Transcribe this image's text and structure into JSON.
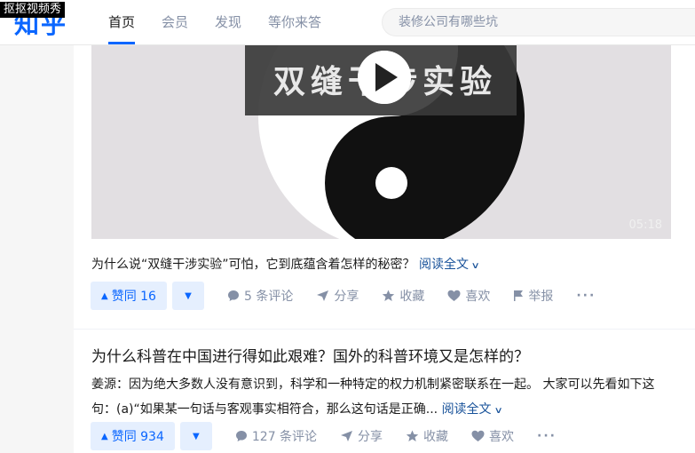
{
  "watermark": "抠抠视频秀",
  "header": {
    "logo": "知乎",
    "nav": [
      "首页",
      "会员",
      "发现",
      "等你来答"
    ],
    "search_placeholder": "装修公司有哪些坑"
  },
  "feed": {
    "item1": {
      "video_overlay_text": "双缝干涉实验",
      "video_duration": "05:18",
      "excerpt": "为什么说“双缝干涉实验”可怕，它到底蕴含着怎样的秘密？",
      "read_more": "阅读全文",
      "vote_up": "赞同 16",
      "comments": "5 条评论",
      "share": "分享",
      "collect": "收藏",
      "like": "喜欢",
      "report": "举报",
      "more": "···"
    },
    "item2": {
      "title": "为什么科普在中国进行得如此艰难？国外的科普环境又是怎样的？",
      "author": "姜源：",
      "excerpt": "因为绝大多数人没有意识到，科学和一种特定的权力机制紧密联系在一起。 大家可以先看如下这句：(a)“如果某一句话与客观事实相符合，那么这句话是正确...",
      "read_more": "阅读全文",
      "vote_up": "赞同 934",
      "comments": "127 条评论",
      "share": "分享",
      "collect": "收藏",
      "like": "喜欢",
      "more": "···"
    }
  },
  "colors": {
    "brand": "#0a66ff",
    "link": "#175199",
    "muted": "#8590a6"
  }
}
